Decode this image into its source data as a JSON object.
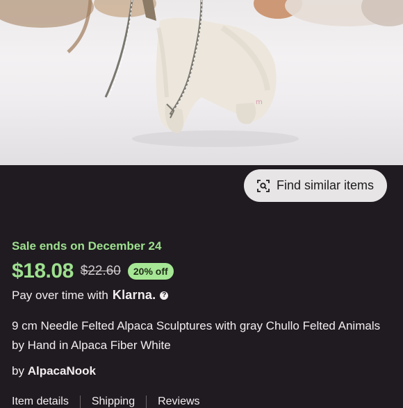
{
  "image": {
    "alt_icon": "product-photo"
  },
  "find_similar": {
    "label": "Find similar items",
    "icon": "image-search-icon"
  },
  "listing": {
    "sale_text": "Sale ends on December 24",
    "price": "$18.08",
    "original_price": "$22.60",
    "discount_badge": "20% off",
    "pay_over_time": "Pay over time with",
    "klarna": "Klarna.",
    "help_icon": "?",
    "title": "9 cm Needle Felted Alpaca Sculptures with gray Chullo Felted Animals by Hand in Alpaca Fiber White",
    "seller_prefix": "by",
    "seller_name": "AlpacaNook"
  },
  "tabs": [
    {
      "label": "Item details"
    },
    {
      "label": "Shipping"
    },
    {
      "label": "Reviews"
    }
  ],
  "colors": {
    "background": "#1f1b20",
    "sale_green": "#9ee08f",
    "badge_green": "#a6e795",
    "button_bg": "#e8e5e7"
  }
}
